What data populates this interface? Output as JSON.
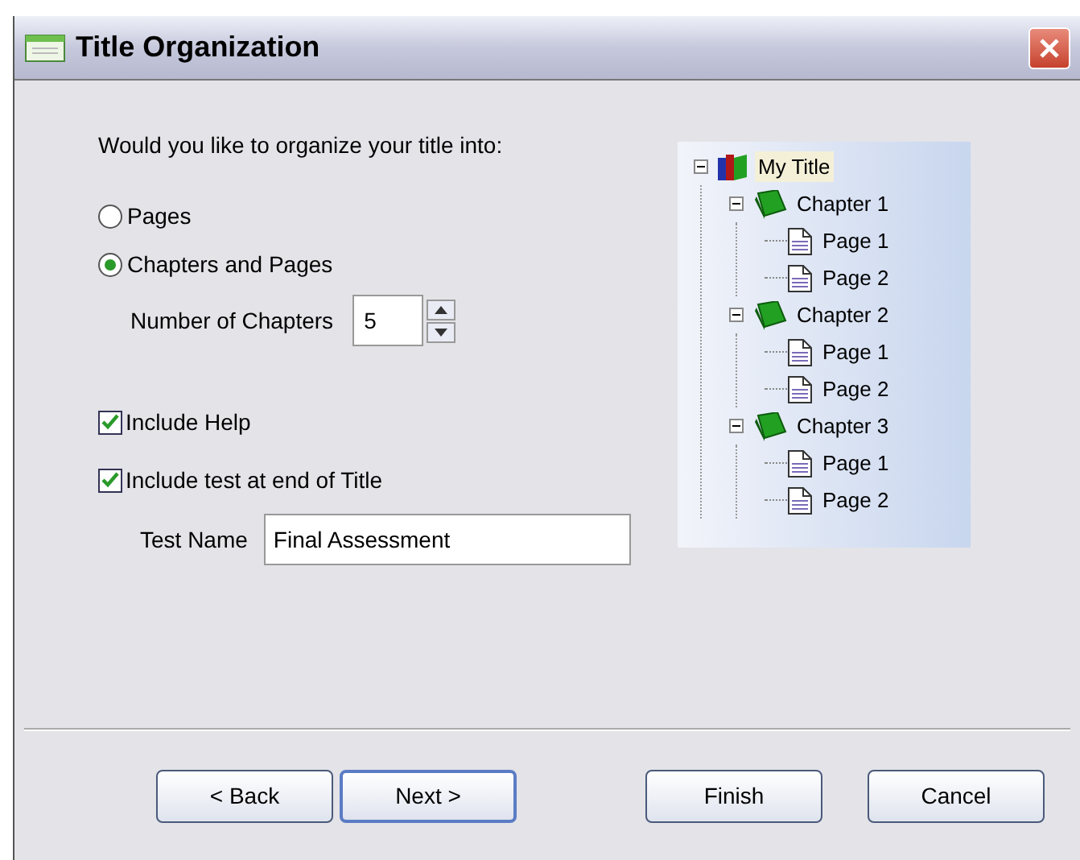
{
  "window": {
    "title": "Title Organization"
  },
  "question": "Would you like to organize your title into:",
  "options": [
    {
      "label": "Pages",
      "selected": false
    },
    {
      "label": "Chapters and Pages",
      "selected": true
    }
  ],
  "chapters": {
    "label": "Number of Chapters",
    "value": "5"
  },
  "checks": [
    {
      "label": "Include Help",
      "checked": true
    },
    {
      "label": "Include test at end of Title",
      "checked": true
    }
  ],
  "test_name": {
    "label": "Test Name",
    "value": "Final Assessment"
  },
  "tree": [
    {
      "label": "My Title",
      "kind": "title",
      "expanded": true,
      "children": [
        {
          "label": "Chapter 1",
          "kind": "chapter",
          "expanded": true,
          "children": [
            {
              "label": "Page 1",
              "kind": "page"
            },
            {
              "label": "Page 2",
              "kind": "page"
            }
          ]
        },
        {
          "label": "Chapter 2",
          "kind": "chapter",
          "expanded": true,
          "children": [
            {
              "label": "Page 1",
              "kind": "page"
            },
            {
              "label": "Page 2",
              "kind": "page"
            }
          ]
        },
        {
          "label": "Chapter 3",
          "kind": "chapter",
          "expanded": true,
          "children": [
            {
              "label": "Page 1",
              "kind": "page"
            },
            {
              "label": "Page 2",
              "kind": "page"
            }
          ]
        }
      ]
    }
  ],
  "buttons": [
    {
      "label": "< Back",
      "default": false
    },
    {
      "label": "Next >",
      "default": true
    },
    {
      "label": "Finish",
      "default": false
    },
    {
      "label": "Cancel",
      "default": false
    }
  ]
}
